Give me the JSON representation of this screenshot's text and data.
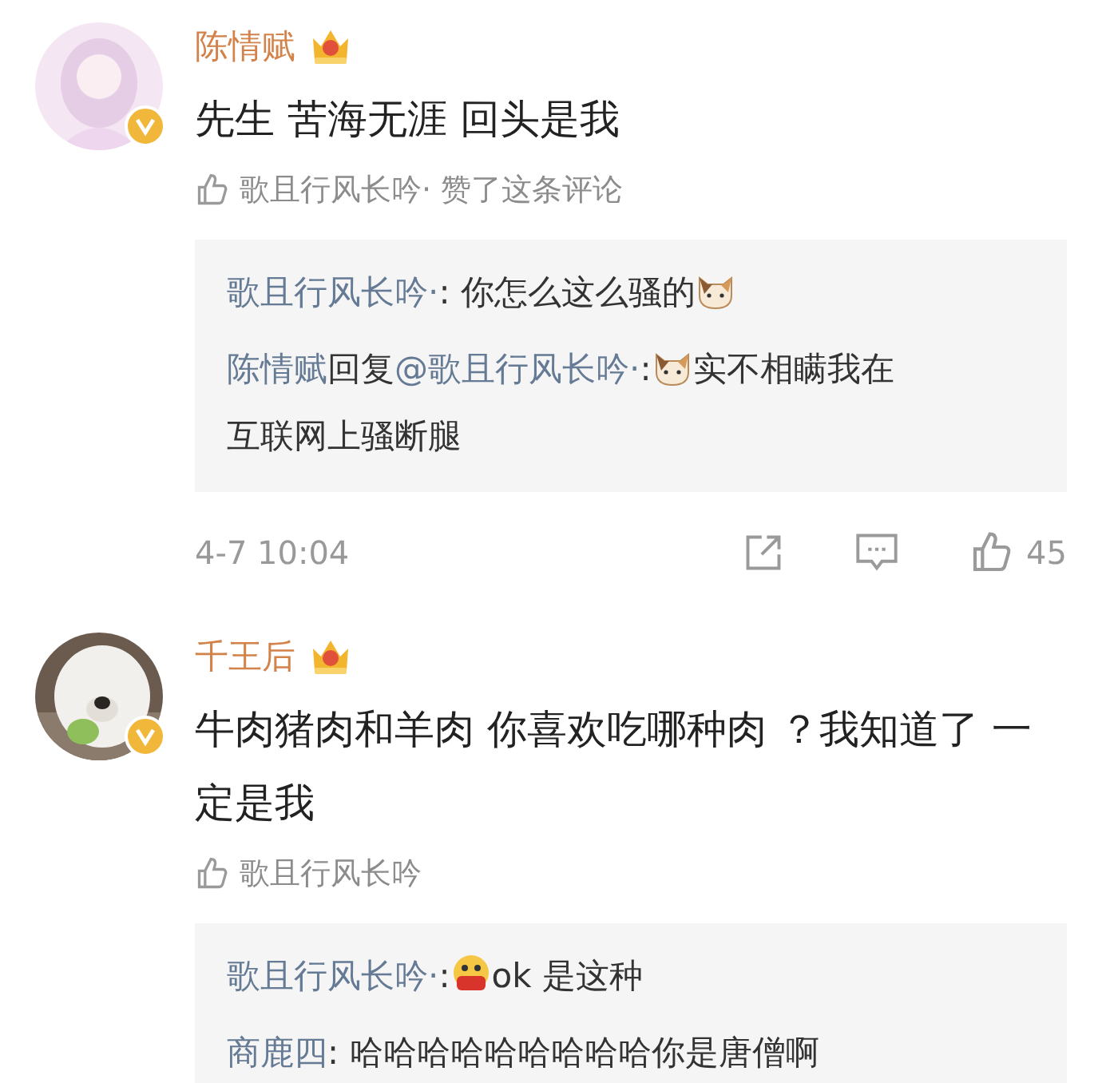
{
  "comments": [
    {
      "author": "陈情赋",
      "avatar": {
        "kind": "picture"
      },
      "verified": true,
      "crown": true,
      "text": "先生 苦海无涯 回头是我",
      "liked_by": "歌且行风长吟· 赞了这条评论",
      "replies": [
        [
          {
            "kind": "user",
            "text": "歌且行风长吟·"
          },
          {
            "kind": "text",
            "text": ": 你怎么这么骚的"
          },
          {
            "kind": "cat_emoji"
          }
        ],
        [
          {
            "kind": "user",
            "text": "陈情赋"
          },
          {
            "kind": "text",
            "text": "回复"
          },
          {
            "kind": "user",
            "text": "@歌且行风长吟·"
          },
          {
            "kind": "text",
            "text": ":"
          },
          {
            "kind": "cat_emoji"
          },
          {
            "kind": "text",
            "text": "实不相瞒我在"
          },
          {
            "kind": "text",
            "text": "互联网上骚断腿"
          }
        ]
      ],
      "footer": {
        "time": "4-7 10:04",
        "likes": "45"
      }
    },
    {
      "author": "千王后",
      "avatar": {
        "kind": "picture"
      },
      "verified": true,
      "crown": true,
      "text": "牛肉猪肉和羊肉 你喜欢吃哪种肉 ？我知道了 一定是我",
      "liked_by": "歌且行风长吟",
      "replies": [
        [
          {
            "kind": "user",
            "text": "歌且行风长吟·"
          },
          {
            "kind": "text",
            "text": ": "
          },
          {
            "kind": "face_emoji"
          },
          {
            "kind": "text",
            "text": "ok 是这种"
          }
        ],
        [
          {
            "kind": "user",
            "text": "商鹿四"
          },
          {
            "kind": "text",
            "text": ": 哈哈哈哈哈哈哈哈哈你是唐僧啊"
          }
        ]
      ]
    }
  ]
}
